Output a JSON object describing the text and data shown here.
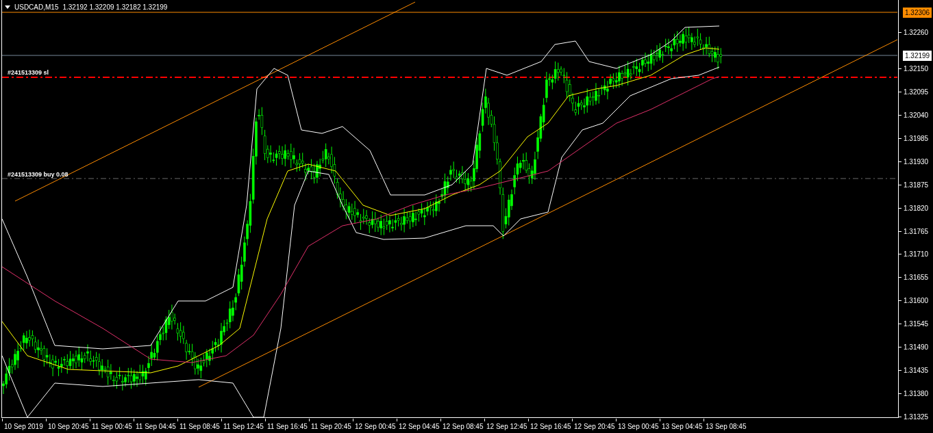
{
  "chart_header": {
    "symbol": "USDCAD,M15",
    "ohlc": "1.32192 1.32209 1.32182 1.32199"
  },
  "price_axis": {
    "labels": [
      "1.32260",
      "1.32150",
      "1.32095",
      "1.32040",
      "1.31985",
      "1.31930",
      "1.31875",
      "1.31820",
      "1.31765",
      "1.31710",
      "1.31655",
      "1.31600",
      "1.31545",
      "1.31490",
      "1.31435",
      "1.31380",
      "1.31325"
    ],
    "markers": [
      {
        "label": "1.32306",
        "color": "#ff8c00"
      },
      {
        "label": "1.32199",
        "color": "#ffffff"
      }
    ]
  },
  "orders": [
    {
      "label": "#241513309 sl",
      "kind": "stop"
    },
    {
      "label": "#241513309 buy 0.08",
      "kind": "entry"
    }
  ],
  "time_axis": {
    "labels": [
      "10 Sep 2019",
      "10 Sep 20:45",
      "11 Sep 00:45",
      "11 Sep 04:45",
      "11 Sep 08:45",
      "11 Sep 12:45",
      "11 Sep 16:45",
      "11 Sep 20:45",
      "12 Sep 00:45",
      "12 Sep 04:45",
      "12 Sep 08:45",
      "12 Sep 12:45",
      "12 Sep 16:45",
      "12 Sep 20:45",
      "13 Sep 00:45",
      "13 Sep 04:45",
      "13 Sep 08:45"
    ]
  }
}
